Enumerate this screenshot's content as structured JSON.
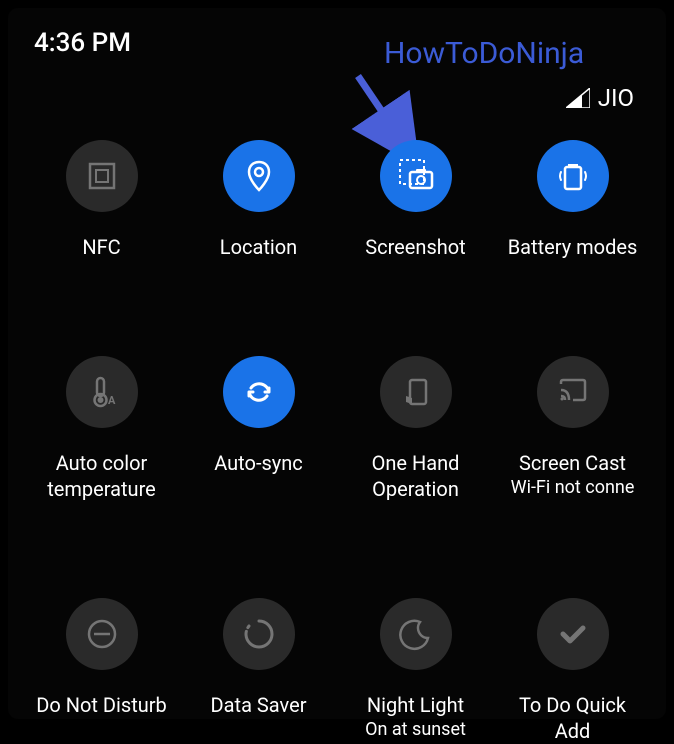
{
  "status": {
    "time": "4:36 PM",
    "carrier": "JIO"
  },
  "annotation": {
    "watermark": "HowToDoNinja"
  },
  "tiles": [
    {
      "id": "nfc",
      "label": "NFC",
      "sublabel": "",
      "active": false
    },
    {
      "id": "location",
      "label": "Location",
      "sublabel": "",
      "active": true
    },
    {
      "id": "screenshot",
      "label": "Screenshot",
      "sublabel": "",
      "active": true
    },
    {
      "id": "battery-modes",
      "label": "Battery modes",
      "sublabel": "",
      "active": true
    },
    {
      "id": "auto-color-temp",
      "label": "Auto color\ntemperature",
      "sublabel": "",
      "active": false
    },
    {
      "id": "auto-sync",
      "label": "Auto-sync",
      "sublabel": "",
      "active": true
    },
    {
      "id": "one-hand",
      "label": "One Hand\nOperation",
      "sublabel": "",
      "active": false
    },
    {
      "id": "screen-cast",
      "label": "Screen Cast",
      "sublabel": "Wi-Fi not conne",
      "active": false
    },
    {
      "id": "dnd",
      "label": "Do Not Disturb",
      "sublabel": "",
      "active": false
    },
    {
      "id": "data-saver",
      "label": "Data Saver",
      "sublabel": "",
      "active": false
    },
    {
      "id": "night-light",
      "label": "Night Light",
      "sublabel": "On at sunset",
      "active": false
    },
    {
      "id": "todo-quick-add",
      "label": "To Do Quick\nAdd",
      "sublabel": "",
      "active": false
    }
  ]
}
